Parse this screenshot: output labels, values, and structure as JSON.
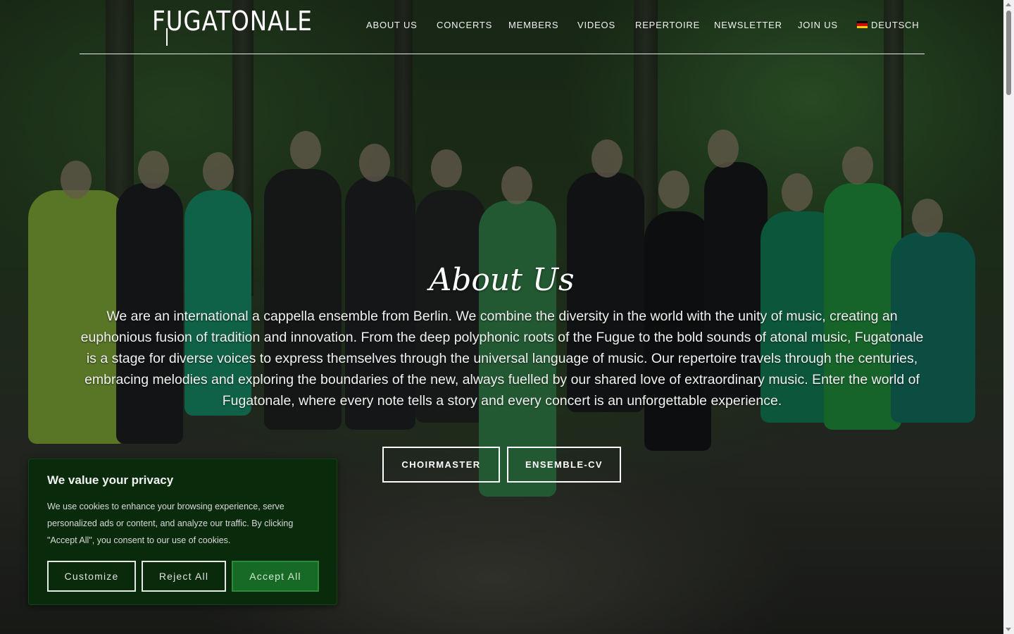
{
  "brand": {
    "logo_text": "FUGATONALE"
  },
  "nav": {
    "items": [
      "ABOUT US",
      "CONCERTS",
      "MEMBERS",
      "VIDEOS",
      "REPERTOIRE",
      "NEWSLETTER",
      "JOIN US"
    ],
    "language": "DEUTSCH",
    "language_flag_icon": "german-flag-icon"
  },
  "main": {
    "title": "About Us",
    "description": "We are an international a cappella ensemble from Berlin. We combine the diversity in the world with the unity of music, creating an euphonious fusion of tradition and innovation. From the deep polyphonic roots of the Fugue to the bold sounds of atonal music, Fugatonale is a stage for diverse voices to express themselves through the universal language of music. Our repertoire travels through the centuries, embracing melodies and exploring the boundaries of the new, always fuelled by our shared love of extraordinary music. Enter the world of Fugatonale, where every note tells a story and every concert is an unforgettable experience.",
    "buttons": [
      "CHOIRMASTER",
      "ENSEMBLE-CV"
    ]
  },
  "cookie_banner": {
    "title": "We value your privacy",
    "text": "We use cookies to enhance your browsing experience, serve personalized ads or content, and analyze our traffic. By clicking \"Accept All\", you consent to our use of cookies.",
    "customize": "Customize",
    "reject": "Reject All",
    "accept": "Accept All"
  },
  "colors": {
    "cookie_bg": "#0a2a0c",
    "accept_bg": "#176a25",
    "flag": [
      "#000000",
      "#dd0000",
      "#ffce00"
    ]
  }
}
